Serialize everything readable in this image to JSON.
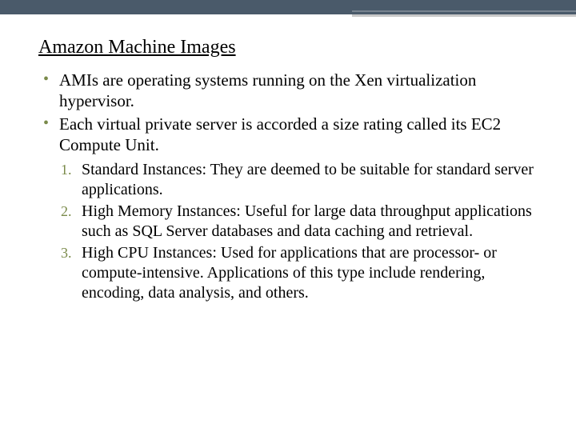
{
  "title": "Amazon Machine Images",
  "bullets": [
    "AMIs are operating systems running on the Xen virtualization hypervisor.",
    "Each virtual private server is accorded a size rating called its EC2 Compute Unit."
  ],
  "numbered": [
    "Standard Instances: They are deemed to be suitable for standard server applications.",
    "High Memory Instances: Useful for large data throughput applications such as SQL Server databases and data caching and retrieval.",
    "High CPU Instances: Used for applications that are processor- or compute-intensive. Applications of this type include rendering, encoding, data analysis, and others."
  ]
}
